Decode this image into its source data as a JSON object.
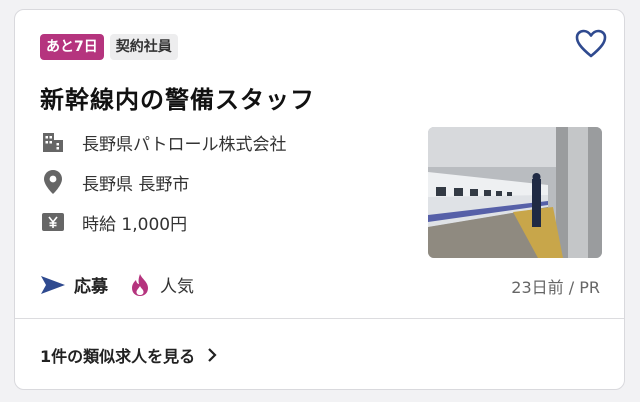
{
  "badges": {
    "deadline": "あと7日",
    "employment_type": "契約社員"
  },
  "job": {
    "title": "新幹線内の警備スタッフ",
    "company": "長野県パトロール株式会社",
    "location": "長野県 長野市",
    "salary": "時給 1,000円"
  },
  "actions": {
    "apply_label": "応募",
    "popular_label": "人気"
  },
  "meta": {
    "posted": "23日前 / PR"
  },
  "footer": {
    "similar_link": "1件の類似求人を見る"
  },
  "colors": {
    "deadline_badge": "#b5347e",
    "favorite": "#2f4a8f",
    "apply_arrow": "#2f4a8f",
    "popular_icon": "#b5347e"
  },
  "icons": [
    "heart-icon",
    "building-icon",
    "location-pin-icon",
    "yen-icon",
    "send-arrow-icon",
    "flame-icon",
    "chevron-right-icon"
  ]
}
